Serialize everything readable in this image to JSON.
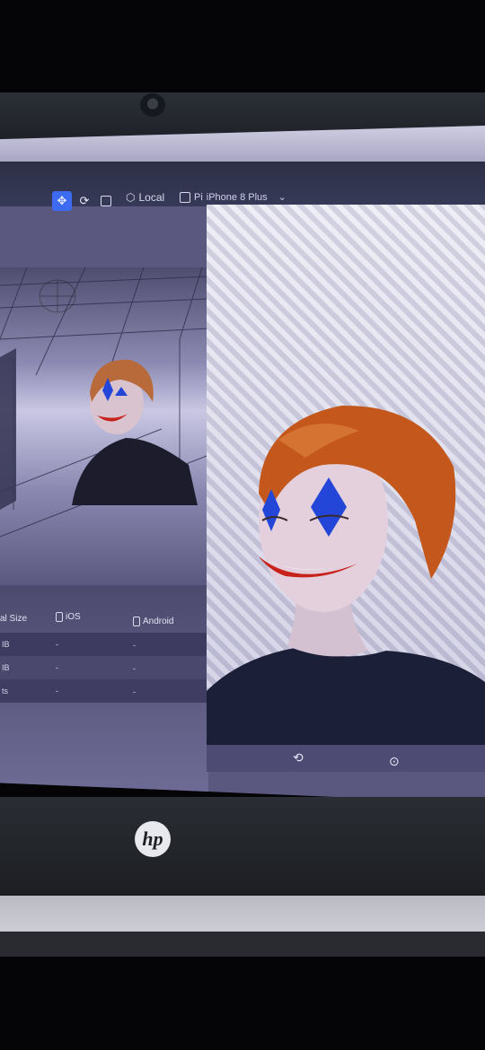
{
  "toolbar": {
    "local_label": "Local",
    "device_prefix": "Pi",
    "device_label": "iPhone 8 Plus",
    "device_chevron": "⌄"
  },
  "table": {
    "headers": {
      "size": "al Size",
      "ios": "iOS",
      "android": "Android"
    },
    "rows": [
      {
        "size": "IB",
        "ios": "-",
        "android": "-"
      },
      {
        "size": "IB",
        "ios": "-",
        "android": "-"
      },
      {
        "size": "ts",
        "ios": "-",
        "android": "-"
      }
    ]
  },
  "icons": {
    "move": "move-icon",
    "rotate": "rotate-icon",
    "scale": "scale-icon",
    "cube": "cube-icon",
    "device": "device-icon",
    "preview_rotate": "rotate-icon",
    "preview_record": "record-icon"
  },
  "brand": {
    "logo": "hp"
  },
  "colors": {
    "accent": "#3d6bf0",
    "lips": "#c8221c",
    "diamonds": "#2346d8",
    "hair": "#c4581c"
  }
}
